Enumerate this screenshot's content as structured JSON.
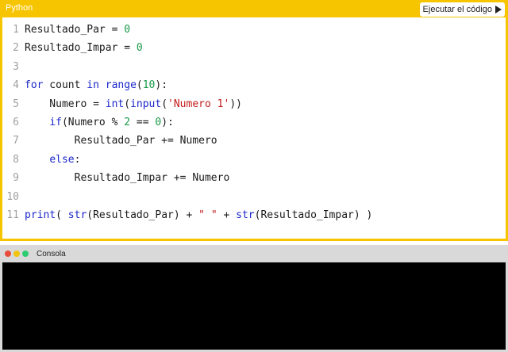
{
  "editor": {
    "language": "Python",
    "run_label": "Ejecutar el código",
    "lines": [
      {
        "n": "1",
        "text": "Resultado_Par = 0"
      },
      {
        "n": "2",
        "text": "Resultado_Impar = 0"
      },
      {
        "n": "3",
        "text": ""
      },
      {
        "n": "4",
        "text": "for count in range(10):"
      },
      {
        "n": "5",
        "text": "    Numero = int(input('Numero 1'))"
      },
      {
        "n": "6",
        "text": "    if(Numero % 2 == 0):"
      },
      {
        "n": "7",
        "text": "        Resultado_Par += Numero"
      },
      {
        "n": "8",
        "text": "    else:"
      },
      {
        "n": "9",
        "text": "        Resultado_Impar += Numero"
      },
      {
        "n": "10",
        "text": ""
      },
      {
        "n": "11",
        "text": "print( str(Resultado_Par) + \" \" + str(Resultado_Impar) )"
      }
    ]
  },
  "console": {
    "title": "Consola"
  },
  "colors": {
    "accent": "#f7c400",
    "keyword": "#1b27c8",
    "number": "#1a9a4a",
    "string": "#c41a1a"
  },
  "icons": {
    "run": "play-icon"
  }
}
